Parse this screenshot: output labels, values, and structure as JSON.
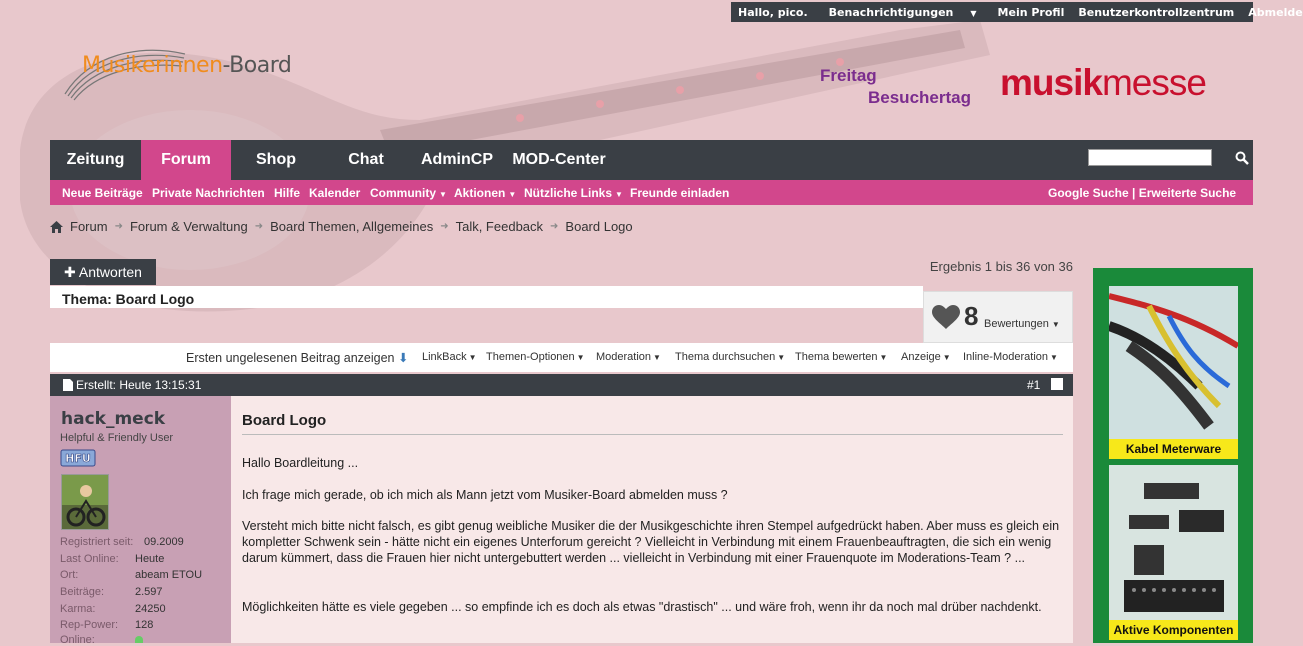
{
  "userbar": {
    "greeting": "Hallo, pico.",
    "notifications": "Benachrichtigungen",
    "profile": "Mein Profil",
    "usercp": "Benutzerkontrollzentrum",
    "logout": "Abmelden"
  },
  "header": {
    "logo_part1": "Musikerinnen",
    "logo_part2": "-Board",
    "banner_line1": "Freitag",
    "banner_line2": "Besuchertag",
    "banner_brand1": "musik",
    "banner_brand2": "messe"
  },
  "mainnav": {
    "tabs": [
      "Zeitung",
      "Forum",
      "Shop",
      "Chat",
      "AdminCP",
      "MOD-Center"
    ],
    "active": "Forum"
  },
  "subnav": {
    "links": [
      "Neue Beiträge",
      "Private Nachrichten",
      "Hilfe",
      "Kalender",
      "Community",
      "Aktionen",
      "Nützliche Links",
      "Freunde einladen"
    ],
    "search_link": "Google Suche | Erweiterte Suche"
  },
  "breadcrumb": [
    "Forum",
    "Forum & Verwaltung",
    "Board Themen, Allgemeines",
    "Talk, Feedback",
    "Board Logo"
  ],
  "thread": {
    "reply_label": "Antworten",
    "results": "Ergebnis 1 bis 36 von 36",
    "title": "Thema: Board Logo",
    "rating_count": "8",
    "rating_label": "Bewertungen"
  },
  "toolbar": {
    "unread": "Ersten ungelesenen Beitrag anzeigen",
    "items": [
      "LinkBack",
      "Themen-Optionen",
      "Moderation",
      "Thema durchsuchen",
      "Thema bewerten",
      "Anzeige",
      "Inline-Moderation"
    ]
  },
  "post": {
    "date": "Erstellt: Heute 13:15:31",
    "number": "#1",
    "title": "Board Logo",
    "paragraphs": [
      "Hallo Boardleitung ...",
      "Ich frage mich gerade, ob ich mich als Mann jetzt vom Musiker-Board abmelden muss ?",
      "Versteht mich bitte nicht falsch, es gibt genug weibliche Musiker die der Musikgeschichte ihren Stempel aufgedrückt haben. Aber muss es gleich ein kompletter Schwenk sein - hätte nicht ein eigenes Unterforum gereicht ? Vielleicht in Verbindung mit einem Frauenbeauftragten, die sich ein wenig darum kümmert, dass die Frauen hier nicht untergebuttert werden ... vielleicht in Verbindung mit einer Frauenquote im Moderations-Team ? ...",
      "Möglichkeiten hätte es viele gegeben ... so empfinde ich es doch als etwas \"drastisch\" ... und wäre froh, wenn ihr da noch mal drüber nachdenkt."
    ]
  },
  "user": {
    "name": "hack_meck",
    "title": "Helpful & Friendly User",
    "badge": "HFU",
    "stats": [
      {
        "label": "Registriert seit:",
        "value": "09.2009"
      },
      {
        "label": "Last Online:",
        "value": "Heute"
      },
      {
        "label": "Ort:",
        "value": "abeam ETOU"
      },
      {
        "label": "Beiträge:",
        "value": "2.597"
      },
      {
        "label": "Karma:",
        "value": "24250"
      },
      {
        "label": "Rep-Power:",
        "value": "128"
      },
      {
        "label": "Online:",
        "value": ""
      }
    ]
  },
  "ads": {
    "ad1_label": "Kabel Meterware",
    "ad2_label": "Aktive Komponenten"
  },
  "colors": {
    "background": "#e8c8cc",
    "nav_dark": "#3a3f45",
    "accent_pink": "#d2478c",
    "ad_green": "#1a8a3a"
  }
}
